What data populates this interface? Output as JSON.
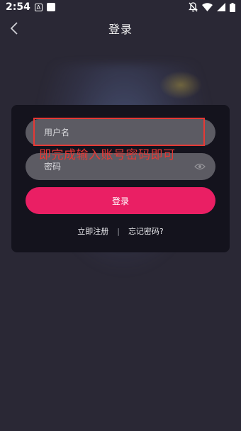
{
  "status_bar": {
    "time": "2:54",
    "notification_badge": "A",
    "icons": [
      "notifications-off-icon",
      "wifi-icon",
      "signal-icon",
      "battery-icon"
    ]
  },
  "header": {
    "title": "登录",
    "back_icon": "chevron-left-icon"
  },
  "form": {
    "username_placeholder": "用户名",
    "password_placeholder": "密码",
    "login_label": "登录",
    "register_label": "立即注册",
    "separator": "|",
    "forgot_label": "忘记密码?"
  },
  "annotation": {
    "text": "即完成输入账号密码即可",
    "color": "#e53935"
  },
  "colors": {
    "background": "#2a2835",
    "card": "#14131d",
    "field": "#5c5b63",
    "accent": "#ea1f64"
  }
}
